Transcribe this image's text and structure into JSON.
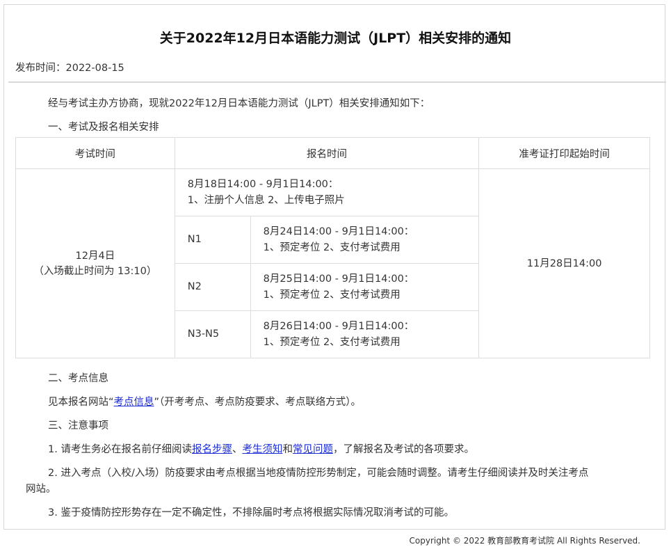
{
  "title": "关于2022年12月日本语能力测试（JLPT）相关安排的通知",
  "publish": {
    "label": "发布时间：",
    "date": "2022-08-15"
  },
  "intro": "经与考试主办方协商，现就2022年12月日本语能力测试（JLPT）相关安排通知如下：",
  "section1": "一、考试及报名相关安排",
  "table": {
    "headers": [
      "考试时间",
      "报名时间",
      "准考证打印起始时间"
    ],
    "exam_date": "12月4日",
    "exam_note": "（入场截止时间为 13:10）",
    "general_reg": {
      "time": "8月18日14:00 - 9月1日14:00：",
      "steps": "1、注册个人信息 2、上传电子照片"
    },
    "levels": [
      {
        "level": "N1",
        "time": "8月24日14:00 - 9月1日14:00：",
        "steps": "1、预定考位 2、支付考试费用"
      },
      {
        "level": "N2",
        "time": "8月25日14:00 - 9月1日14:00：",
        "steps": "1、预定考位 2、支付考试费用"
      },
      {
        "level": "N3-N5",
        "time": "8月26日14:00 - 9月1日14:00：",
        "steps": "1、预定考位 2、支付考试费用"
      }
    ],
    "print_time": "11月28日14:00"
  },
  "section2": "二、考点信息",
  "venue": {
    "pre": "见本报名网站“",
    "link": "考点信息",
    "post": "”（开考考点、考点防疫要求、考点联络方式）。"
  },
  "section3": "三、注意事项",
  "note1": {
    "pre": "1. 请考生务必在报名前仔细阅读",
    "link1": "报名步骤",
    "sep1": "、",
    "link2": "考生须知",
    "sep2": "和",
    "link3": "常见问题",
    "post": "，了解报名及考试的各项要求。"
  },
  "note2_line1": "2. 进入考点（入校/入场）防疫要求由考点根据当地疫情防控形势制定，可能会随时调整。请考生仔细阅读并及时关注考点",
  "note2_line2": "网站。",
  "note3": "3. 鉴于疫情防控形势存在一定不确定性，不排除届时考点将根据实际情况取消考试的可能。",
  "footer": "Copyright © 2022 教育部教育考试院 All Rights Reserved."
}
